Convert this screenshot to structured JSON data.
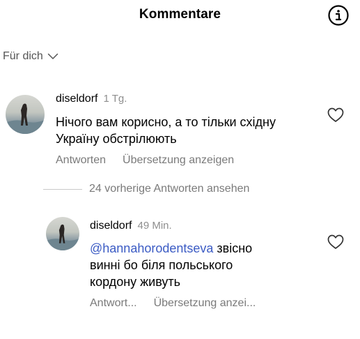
{
  "header": {
    "title": "Kommentare",
    "info_icon": "info-circle-icon"
  },
  "filter": {
    "label": "Für dich",
    "icon": "chevron-down-icon"
  },
  "comments": [
    {
      "username": "diseldorf",
      "time": "1 Tg.",
      "text": "Нічого вам корисно, а то тільки східну Україну обстрілюють",
      "reply_label": "Antworten",
      "translate_label": "Übersetzung anzeigen"
    }
  ],
  "replies_toggle": {
    "label": "24 vorherige Antworten ansehen"
  },
  "replies": [
    {
      "username": "diseldorf",
      "time": "49 Min.",
      "mention": "@hannahorodentseva",
      "text": " звісно винні бо біля польського кордону живуть",
      "reply_label": "Antwort...",
      "translate_label": "Übersetzung anzei..."
    }
  ],
  "colors": {
    "mention": "#3b5bc4",
    "muted": "#7a7a7a"
  }
}
